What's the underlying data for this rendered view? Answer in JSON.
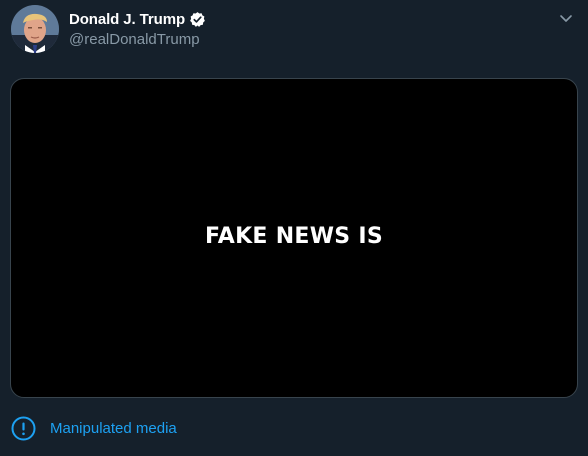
{
  "tweet": {
    "author": {
      "display_name": "Donald J. Trump",
      "handle": "@realDonaldTrump",
      "verified": true,
      "avatar_icon": "profile-photo"
    },
    "menu_icon": "chevron-down-icon",
    "media": {
      "caption": "FAKE NEWS IS"
    },
    "notice": {
      "icon": "exclamation-circle-icon",
      "label": "Manipulated media"
    }
  },
  "colors": {
    "background": "#15202b",
    "link": "#1da1f2",
    "secondary_text": "#8899a6",
    "border": "#38444d"
  }
}
